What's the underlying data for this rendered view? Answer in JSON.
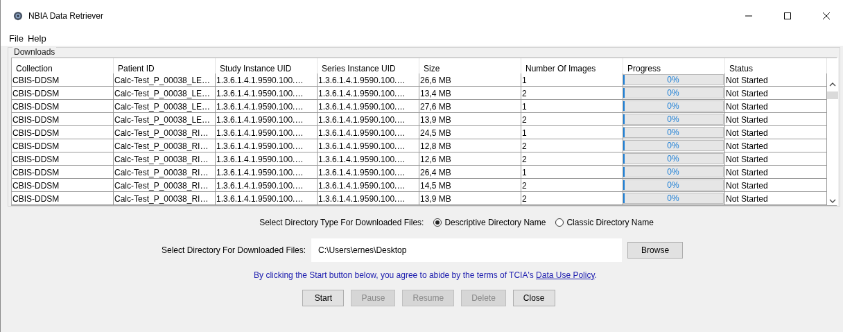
{
  "window": {
    "title": "NBIA Data Retriever"
  },
  "menu": [
    "File",
    "Help"
  ],
  "downloads": {
    "title": "Downloads",
    "columns": [
      "Collection",
      "Patient ID",
      "Study Instance UID",
      "Series Instance UID",
      "Size",
      "Number Of Images",
      "Progress",
      "Status"
    ],
    "rows": [
      {
        "collection": "CBIS-DDSM",
        "patient_id": "Calc-Test_P_00038_LE…",
        "study_uid": "1.3.6.1.4.1.9590.100.…",
        "series_uid": "1.3.6.1.4.1.9590.100.…",
        "size": "26,6 MB",
        "images": "1",
        "level": 0,
        "progress": "0%",
        "status": "Not Started"
      },
      {
        "collection": "CBIS-DDSM",
        "patient_id": "Calc-Test_P_00038_LE…",
        "study_uid": "1.3.6.1.4.1.9590.100.…",
        "series_uid": "1.3.6.1.4.1.9590.100.…",
        "size": "13,4 MB",
        "images": "2",
        "level": 0,
        "progress": "0%",
        "status": "Not Started"
      },
      {
        "collection": "CBIS-DDSM",
        "patient_id": "Calc-Test_P_00038_LE…",
        "study_uid": "1.3.6.1.4.1.9590.100.…",
        "series_uid": "1.3.6.1.4.1.9590.100.…",
        "size": "27,6 MB",
        "images": "1",
        "level": 0,
        "progress": "0%",
        "status": "Not Started"
      },
      {
        "collection": "CBIS-DDSM",
        "patient_id": "Calc-Test_P_00038_LE…",
        "study_uid": "1.3.6.1.4.1.9590.100.…",
        "series_uid": "1.3.6.1.4.1.9590.100.…",
        "size": "13,9 MB",
        "images": "2",
        "level": 0,
        "progress": "0%",
        "status": "Not Started"
      },
      {
        "collection": "CBIS-DDSM",
        "patient_id": "Calc-Test_P_00038_RI…",
        "study_uid": "1.3.6.1.4.1.9590.100.…",
        "series_uid": "1.3.6.1.4.1.9590.100.…",
        "size": "24,5 MB",
        "images": "1",
        "level": 0,
        "progress": "0%",
        "status": "Not Started"
      },
      {
        "collection": "CBIS-DDSM",
        "patient_id": "Calc-Test_P_00038_RI…",
        "study_uid": "1.3.6.1.4.1.9590.100.…",
        "series_uid": "1.3.6.1.4.1.9590.100.…",
        "size": "12,8 MB",
        "images": "2",
        "level": 0,
        "progress": "0%",
        "status": "Not Started"
      },
      {
        "collection": "CBIS-DDSM",
        "patient_id": "Calc-Test_P_00038_RI…",
        "study_uid": "1.3.6.1.4.1.9590.100.…",
        "series_uid": "1.3.6.1.4.1.9590.100.…",
        "size": "12,6 MB",
        "images": "2",
        "level": 0,
        "progress": "0%",
        "status": "Not Started"
      },
      {
        "collection": "CBIS-DDSM",
        "patient_id": "Calc-Test_P_00038_RI…",
        "study_uid": "1.3.6.1.4.1.9590.100.…",
        "series_uid": "1.3.6.1.4.1.9590.100.…",
        "size": "26,4 MB",
        "images": "1",
        "level": 0,
        "progress": "0%",
        "status": "Not Started"
      },
      {
        "collection": "CBIS-DDSM",
        "patient_id": "Calc-Test_P_00038_RI…",
        "study_uid": "1.3.6.1.4.1.9590.100.…",
        "series_uid": "1.3.6.1.4.1.9590.100.…",
        "size": "14,5 MB",
        "images": "2",
        "level": 0,
        "progress": "0%",
        "status": "Not Started"
      },
      {
        "collection": "CBIS-DDSM",
        "patient_id": "Calc-Test_P_00038_RI…",
        "study_uid": "1.3.6.1.4.1.9590.100.…",
        "series_uid": "1.3.6.1.4.1.9590.100.…",
        "size": "13,9 MB",
        "images": "2",
        "level": 0,
        "progress": "0%",
        "status": "Not Started"
      }
    ]
  },
  "directory_type": {
    "label": "Select Directory Type For Downloaded Files:",
    "options": [
      {
        "label": "Descriptive Directory Name",
        "selected": true
      },
      {
        "label": "Classic Directory Name",
        "selected": false
      }
    ]
  },
  "directory": {
    "label": "Select Directory For Downloaded Files:",
    "value": "C:\\Users\\ernes\\Desktop",
    "browse": "Browse"
  },
  "agreement": {
    "text": "By clicking the Start button below, you agree to abide by the terms of TCIA's ",
    "link": "Data Use Policy",
    "end": "."
  },
  "buttons": [
    {
      "label": "Start",
      "disabled": false
    },
    {
      "label": "Pause",
      "disabled": true
    },
    {
      "label": "Resume",
      "disabled": true
    },
    {
      "label": "Delete",
      "disabled": true
    },
    {
      "label": "Close",
      "disabled": false
    }
  ]
}
